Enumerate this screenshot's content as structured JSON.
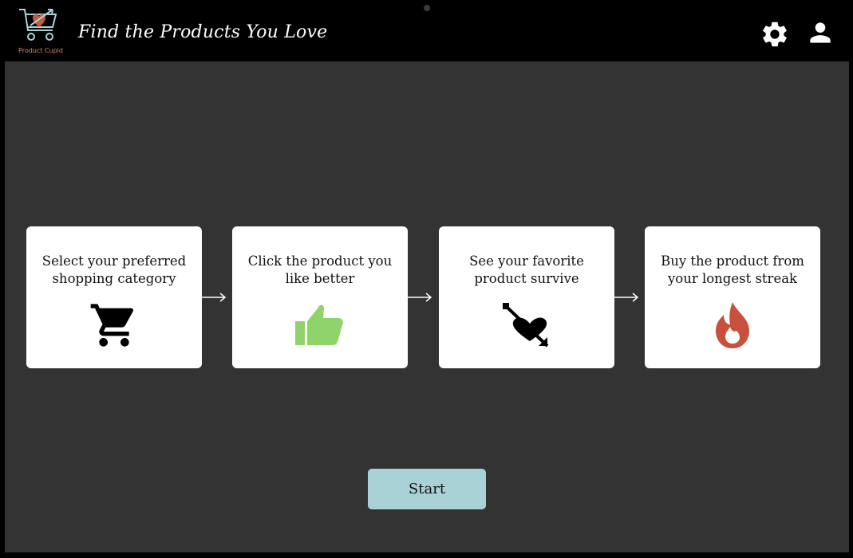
{
  "header": {
    "logo_text": "Product Cupid",
    "tagline": "Find the Products You Love"
  },
  "steps": [
    {
      "caption": "Select your preferred shopping category",
      "icon": "shopping-cart-icon"
    },
    {
      "caption": "Click the product you like better",
      "icon": "thumbs-up-icon"
    },
    {
      "caption": "See your favorite product survive",
      "icon": "heart-arrow-icon"
    },
    {
      "caption": "Buy the product from your longest streak",
      "icon": "fire-icon"
    }
  ],
  "start_button": {
    "label": "Start"
  },
  "colors": {
    "page_bg": "#333333",
    "header_bg": "#000000",
    "card_bg": "#ffffff",
    "start_button_bg": "#a8d2d6",
    "thumbs_up": "#8fd46a",
    "fire": "#c9503c",
    "logo_heart": "#c8573f",
    "logo_cart": "#a8d2d6"
  }
}
